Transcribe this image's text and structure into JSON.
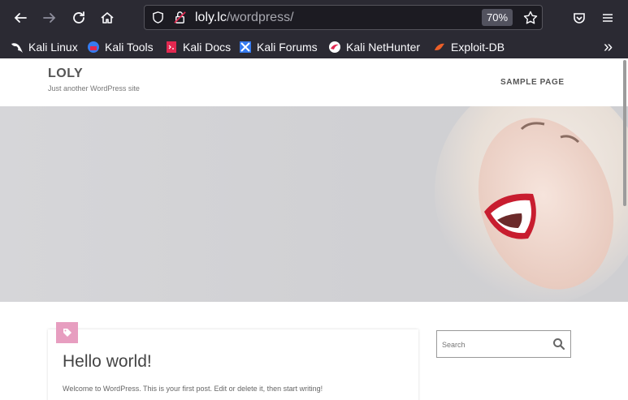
{
  "browser": {
    "url_host": "loly.lc",
    "url_path": "/wordpress/",
    "zoom": "70%",
    "bookmarks": [
      {
        "label": "Kali Linux",
        "icon": "kali-dragon-icon"
      },
      {
        "label": "Kali Tools",
        "icon": "kali-tools-icon"
      },
      {
        "label": "Kali Docs",
        "icon": "kali-docs-icon"
      },
      {
        "label": "Kali Forums",
        "icon": "kali-forums-icon"
      },
      {
        "label": "Kali NetHunter",
        "icon": "nethunter-icon"
      },
      {
        "label": "Exploit-DB",
        "icon": "exploit-db-icon"
      }
    ],
    "overflow_label": "»"
  },
  "site": {
    "title": "LOLY",
    "tagline": "Just another WordPress site",
    "nav": [
      "SAMPLE PAGE"
    ]
  },
  "post": {
    "title": "Hello world!",
    "excerpt": "Welcome to WordPress. This is your first post. Edit or delete it, then start writing!"
  },
  "sidebar": {
    "search_placeholder": "Search"
  },
  "colors": {
    "tag_badge": "#e79ec0",
    "browser_toolbar": "#2b2a33"
  }
}
